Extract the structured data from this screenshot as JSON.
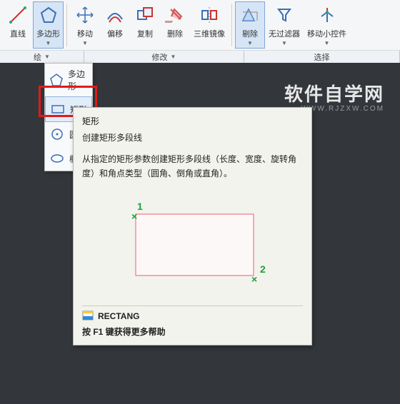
{
  "ribbon": {
    "tools": {
      "line": "直线",
      "polygon": "多边形",
      "move": "移动",
      "offset": "偏移",
      "copy": "复制",
      "delete": "删除",
      "mirror3d": "三维镜像",
      "trim": "剔除",
      "nofilter": "无过滤器",
      "movegizmo": "移动小控件"
    },
    "panels": {
      "draw": "绘",
      "modify": "修改",
      "select": "选择"
    }
  },
  "dropdown": {
    "polygon": "多边形",
    "rectangle": "矩形",
    "circle": "圆",
    "ellipse": "椭"
  },
  "tooltip": {
    "title": "矩形",
    "subtitle": "创建矩形多段线",
    "body": "从指定的矩形参数创建矩形多段线（长度、宽度、旋转角度）和角点类型（圆角、倒角或直角）。",
    "points": {
      "p1": "1",
      "p2": "2"
    },
    "command": "RECTANG",
    "f1": "按 F1 键获得更多帮助"
  },
  "watermark": {
    "line1": "软件自学网",
    "line2": "WWW.RJZXW.COM"
  }
}
